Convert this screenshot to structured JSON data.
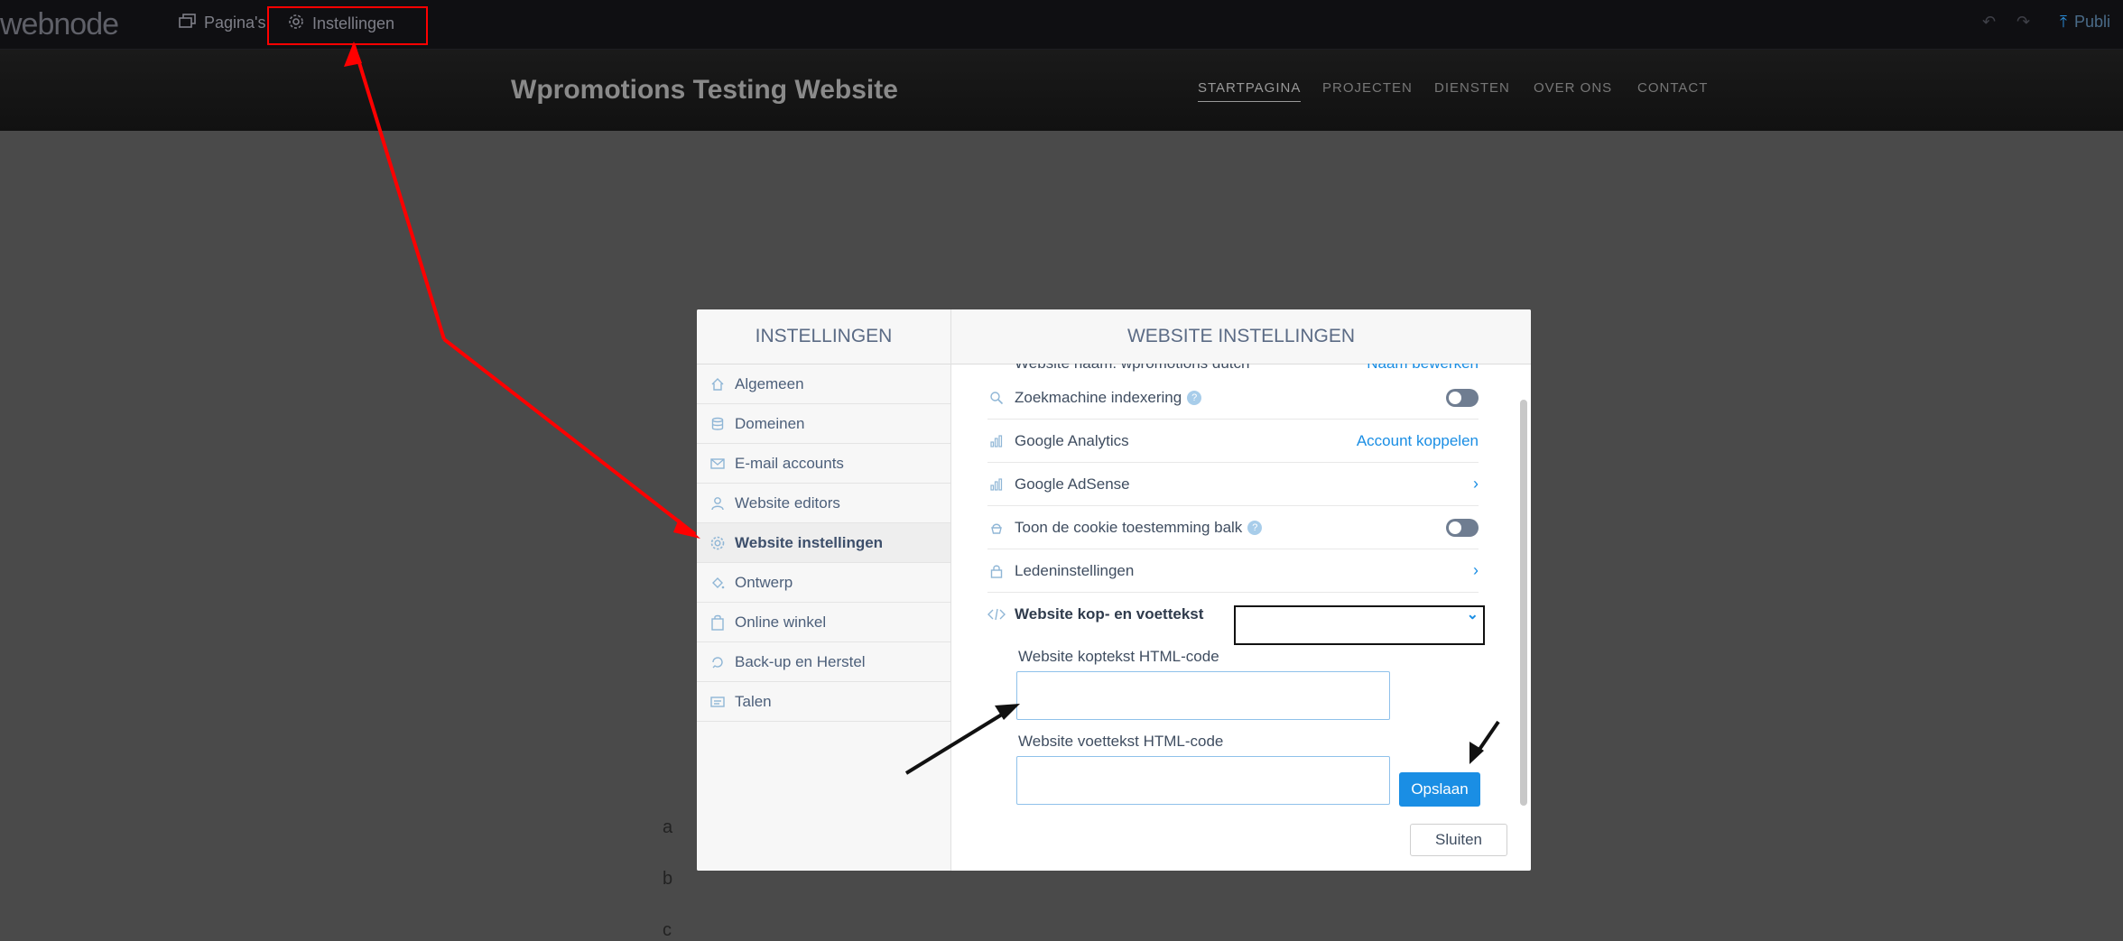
{
  "topbar": {
    "logo": "webnode",
    "pages_label": "Pagina's",
    "settings_label": "Instellingen",
    "publish_label": "Publi"
  },
  "site": {
    "title": "Wpromotions Testing Website",
    "nav": [
      "STARTPAGINA",
      "PROJECTEN",
      "DIENSTEN",
      "OVER ONS",
      "CONTACT"
    ],
    "bg_letters": [
      "a",
      "b",
      "c"
    ]
  },
  "modal": {
    "sidebar_title": "INSTELLINGEN",
    "sidebar_items": [
      {
        "label": "Algemeen",
        "icon": "home-icon"
      },
      {
        "label": "Domeinen",
        "icon": "database-icon"
      },
      {
        "label": "E-mail accounts",
        "icon": "envelope-icon"
      },
      {
        "label": "Website editors",
        "icon": "user-icon"
      },
      {
        "label": "Website instellingen",
        "icon": "gear-icon",
        "active": true
      },
      {
        "label": "Ontwerp",
        "icon": "paint-bucket-icon"
      },
      {
        "label": "Online winkel",
        "icon": "shopping-bag-icon"
      },
      {
        "label": "Back-up en Herstel",
        "icon": "history-icon"
      },
      {
        "label": "Talen",
        "icon": "language-icon"
      }
    ],
    "main_title": "WEBSITE INSTELLINGEN",
    "cut_row": {
      "label": "Website naam: wpromotions dutch",
      "link": "Naam bewerken"
    },
    "rows": [
      {
        "label": "Zoekmachine indexering",
        "control": "toggle",
        "help": "?"
      },
      {
        "label": "Google Analytics",
        "control": "link",
        "link": "Account koppelen"
      },
      {
        "label": "Google AdSense",
        "control": "chevron"
      },
      {
        "label": "Toon de cookie toestemming balk",
        "control": "toggle",
        "help": "?"
      },
      {
        "label": "Ledeninstellingen",
        "control": "chevron"
      },
      {
        "label": "Website kop- en voettekst",
        "control": "chevron-down"
      }
    ],
    "header_code_label": "Website koptekst HTML-code",
    "footer_code_label": "Website voettekst HTML-code",
    "header_code_value": "",
    "footer_code_value": "",
    "save_label": "Opslaan",
    "close_label": "Sluiten"
  },
  "colors": {
    "accent": "#1a8ee4",
    "annotation_red": "#ff0000",
    "annotation_black": "#111111"
  }
}
